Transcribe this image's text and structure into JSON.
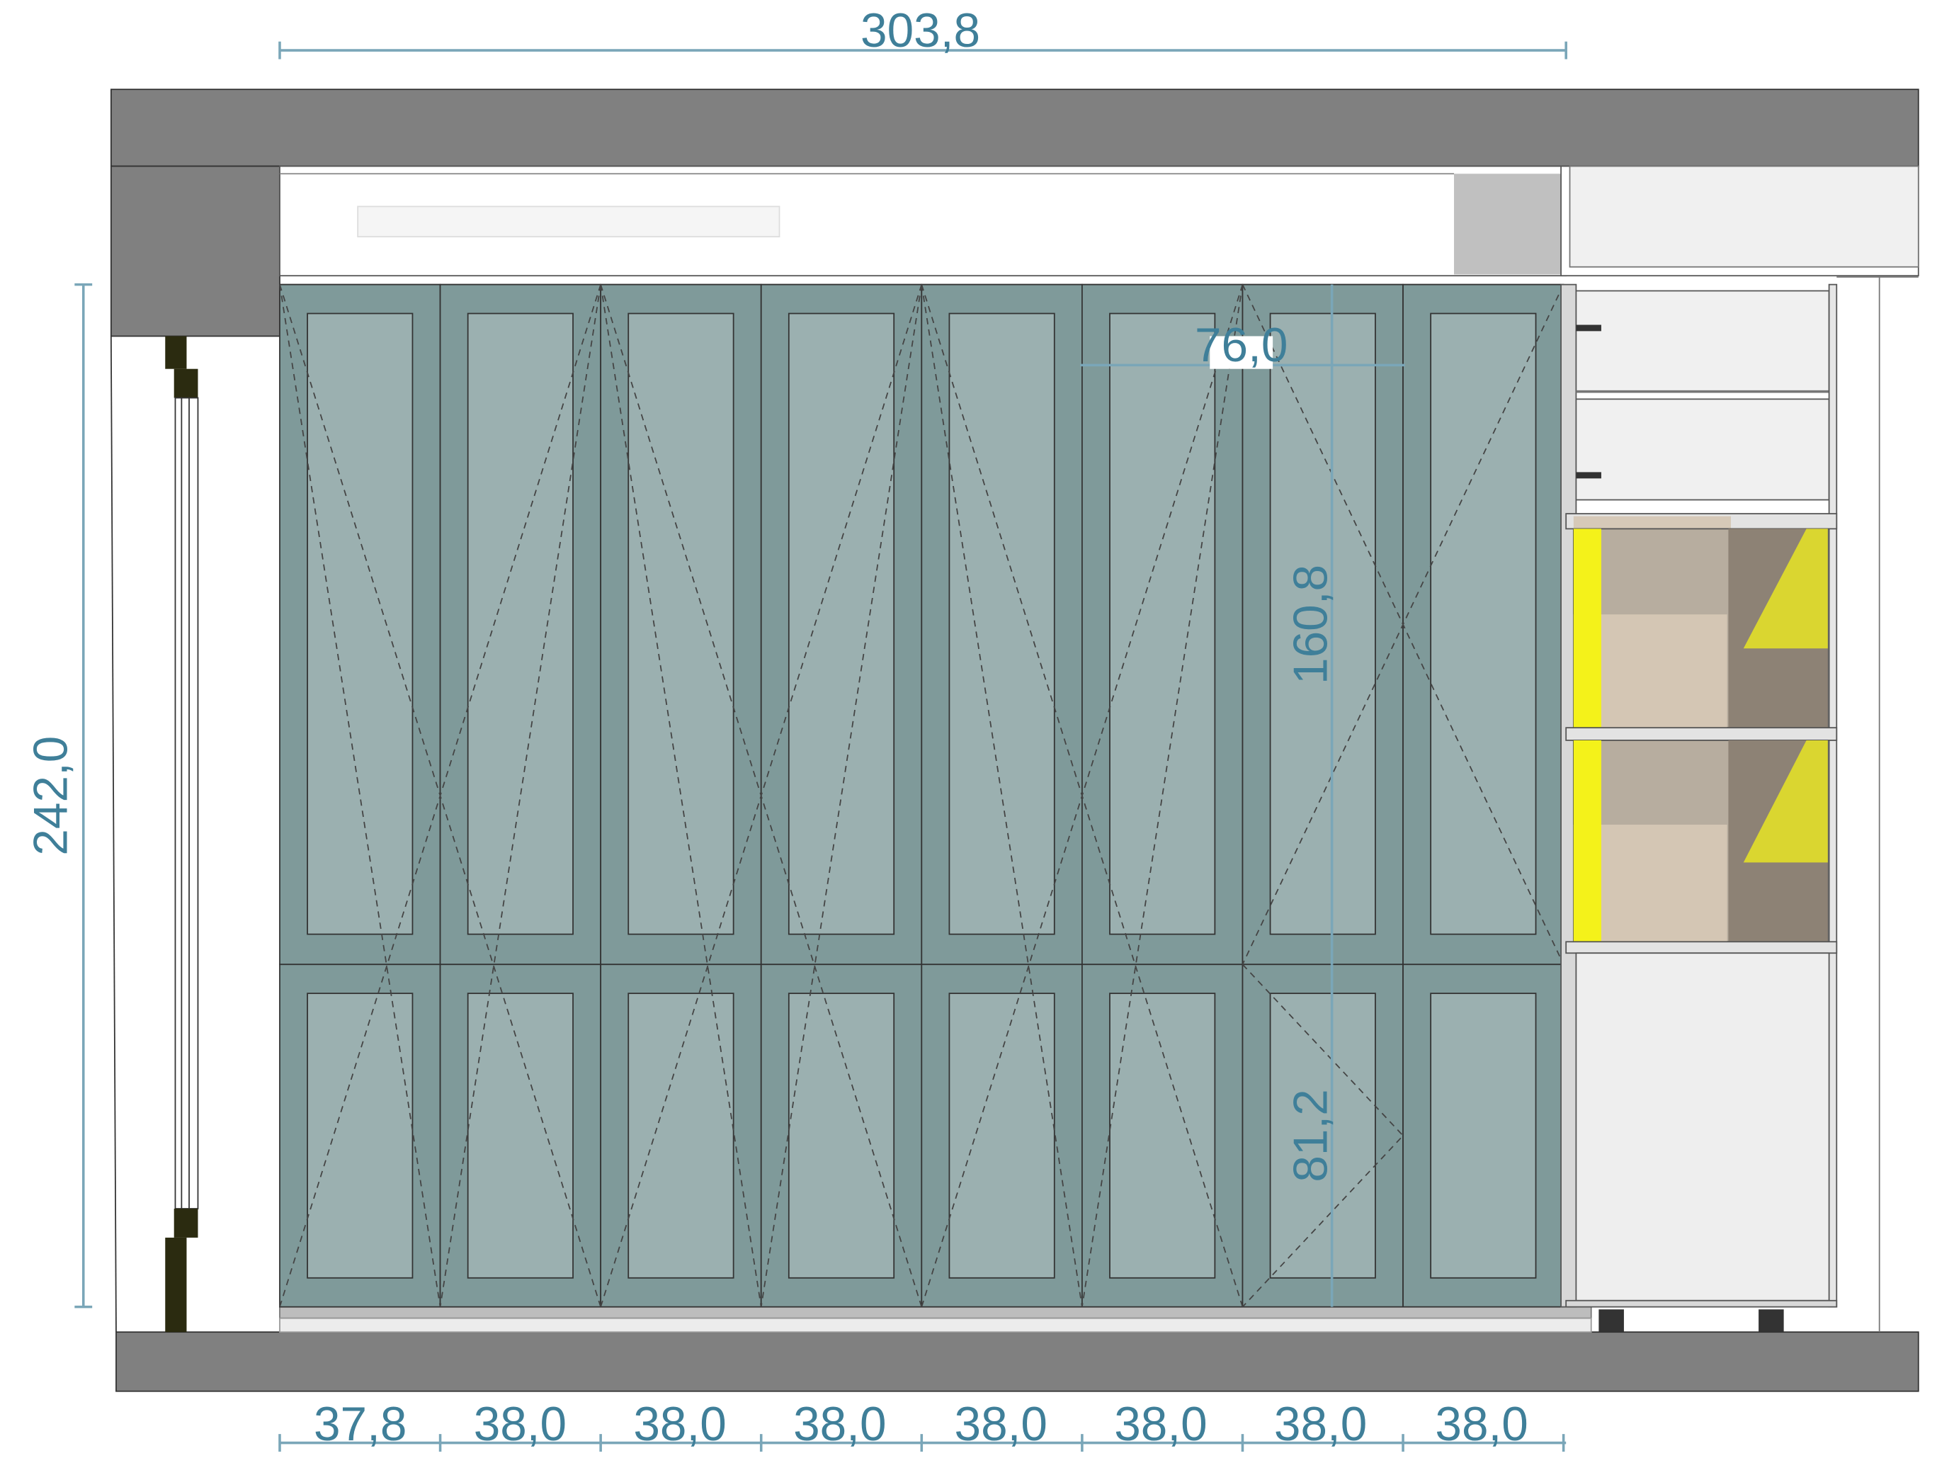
{
  "dimensions": {
    "total_width": "303,8",
    "total_height": "242,0",
    "door_pair_width": "76,0",
    "upper_height": "160,8",
    "lower_height": "81,2",
    "bottom_widths": [
      "37,8",
      "38,0",
      "38,0",
      "38,0",
      "38,0",
      "38,0",
      "38,0",
      "38,0"
    ]
  },
  "colors": {
    "door": "#7f9a9a",
    "door_panel": "#9bb0b0",
    "wall": "#808080",
    "dimension": "#3f7f99",
    "led": "#f4f21a"
  }
}
